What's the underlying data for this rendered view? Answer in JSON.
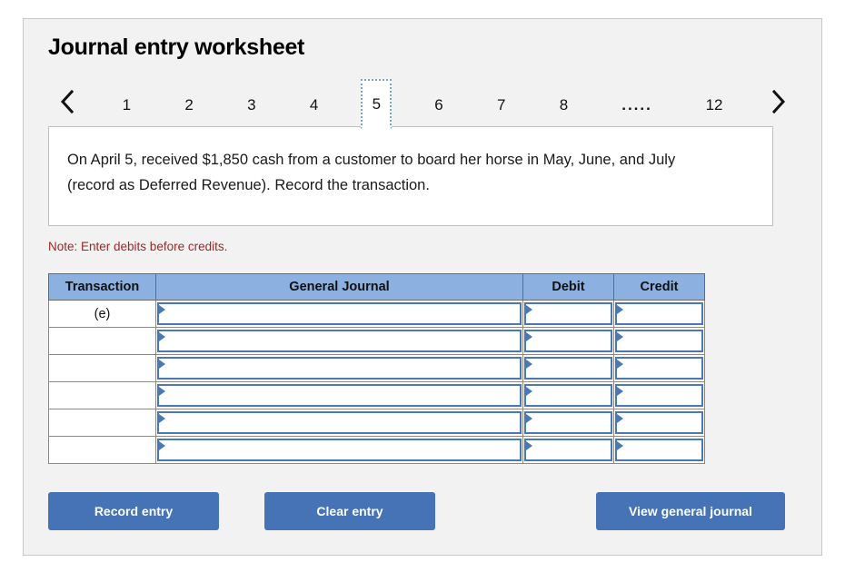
{
  "worksheet": {
    "title": "Journal entry worksheet"
  },
  "pager": {
    "prev_icon": "chevron-left-icon",
    "next_icon": "chevron-right-icon",
    "active_tab": "5",
    "tabs": [
      {
        "label": "1",
        "active": false
      },
      {
        "label": "2",
        "active": false
      },
      {
        "label": "3",
        "active": false
      },
      {
        "label": "4",
        "active": false
      },
      {
        "label": "5",
        "active": true
      },
      {
        "label": "6",
        "active": false
      },
      {
        "label": "7",
        "active": false
      },
      {
        "label": "8",
        "active": false
      },
      {
        "label": ".....",
        "active": false
      },
      {
        "label": "12",
        "active": false
      }
    ]
  },
  "question": {
    "text": "On April 5, received $1,850 cash from a customer to board her horse in May, June, and July (record as Deferred Revenue). Record the transaction."
  },
  "note": {
    "text": "Note: Enter debits before credits."
  },
  "table": {
    "headers": {
      "transaction": "Transaction",
      "general_journal": "General Journal",
      "debit": "Debit",
      "credit": "Credit"
    },
    "rows": [
      {
        "transaction": "(e)",
        "general_journal": "",
        "debit": "",
        "credit": ""
      },
      {
        "transaction": "",
        "general_journal": "",
        "debit": "",
        "credit": ""
      },
      {
        "transaction": "",
        "general_journal": "",
        "debit": "",
        "credit": ""
      },
      {
        "transaction": "",
        "general_journal": "",
        "debit": "",
        "credit": ""
      },
      {
        "transaction": "",
        "general_journal": "",
        "debit": "",
        "credit": ""
      },
      {
        "transaction": "",
        "general_journal": "",
        "debit": "",
        "credit": ""
      }
    ]
  },
  "buttons": {
    "record": "Record entry",
    "clear": "Clear entry",
    "view": "View general journal"
  },
  "colors": {
    "button_blue": "#4573b5",
    "header_blue": "#8cb0e0",
    "input_border_blue": "#4a78b5",
    "note_red": "#a02727",
    "card_bg": "#f2f2f2"
  }
}
